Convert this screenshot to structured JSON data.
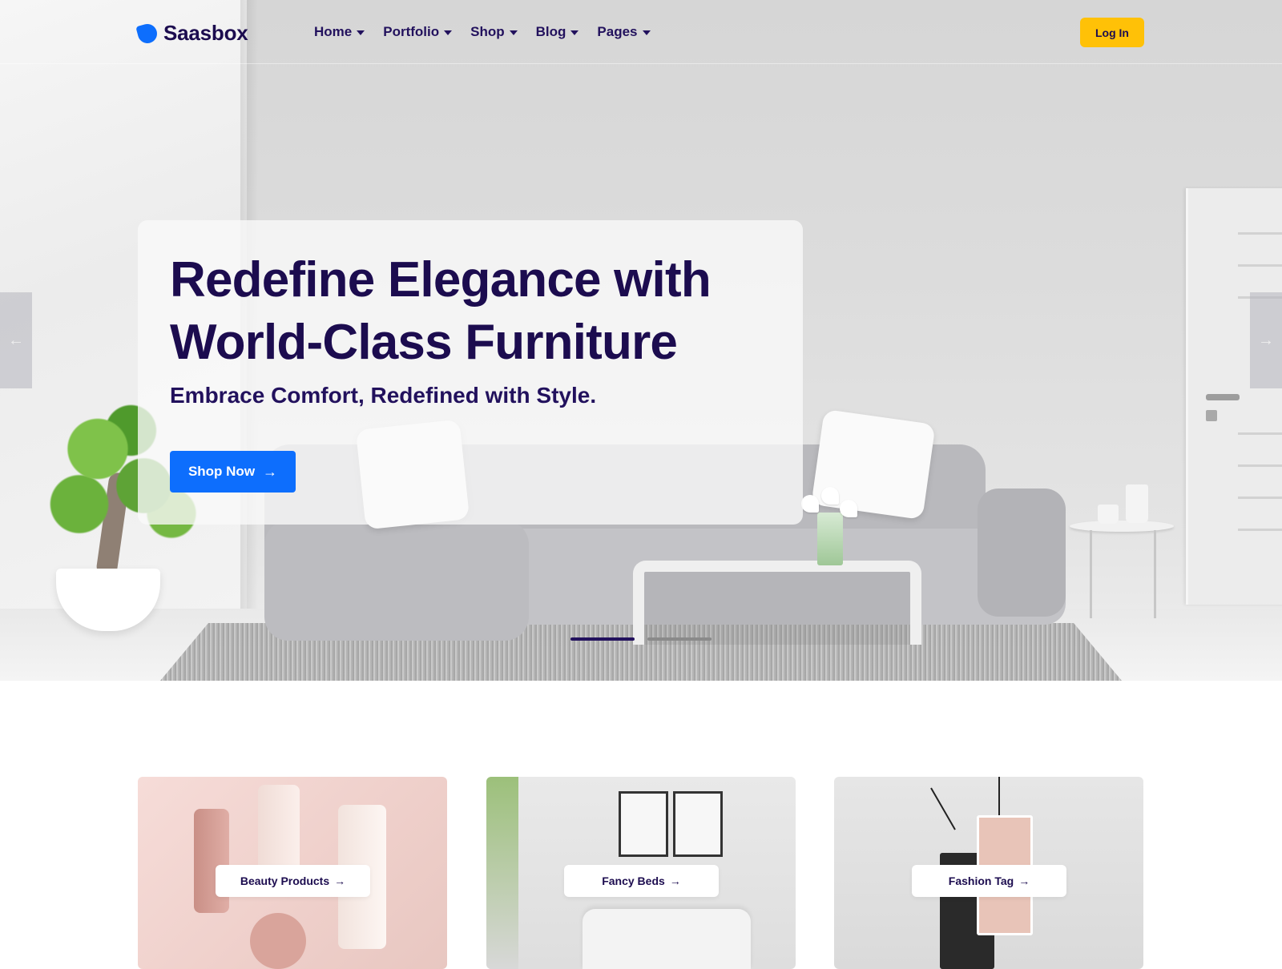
{
  "header": {
    "brand": "Saasbox",
    "nav": [
      {
        "label": "Home"
      },
      {
        "label": "Portfolio"
      },
      {
        "label": "Shop"
      },
      {
        "label": "Blog"
      },
      {
        "label": "Pages"
      }
    ],
    "login_label": "Log In"
  },
  "hero": {
    "title": "Redefine Elegance with World-Class Furniture",
    "subtitle": "Embrace Comfort, Redefined with Style.",
    "cta_label": "Shop Now",
    "cta_icon": "arrow-right-icon",
    "prev_icon": "arrow-left-icon",
    "next_icon": "arrow-right-icon",
    "slides_total": 2,
    "active_slide": 1
  },
  "categories": [
    {
      "label": "Beauty Products"
    },
    {
      "label": "Fancy Beds"
    },
    {
      "label": "Fashion Tag"
    }
  ],
  "colors": {
    "brand": "#0d6efd",
    "heading": "#1c0c4f",
    "login_bg": "#ffc107",
    "dot_active": "#22115d"
  }
}
